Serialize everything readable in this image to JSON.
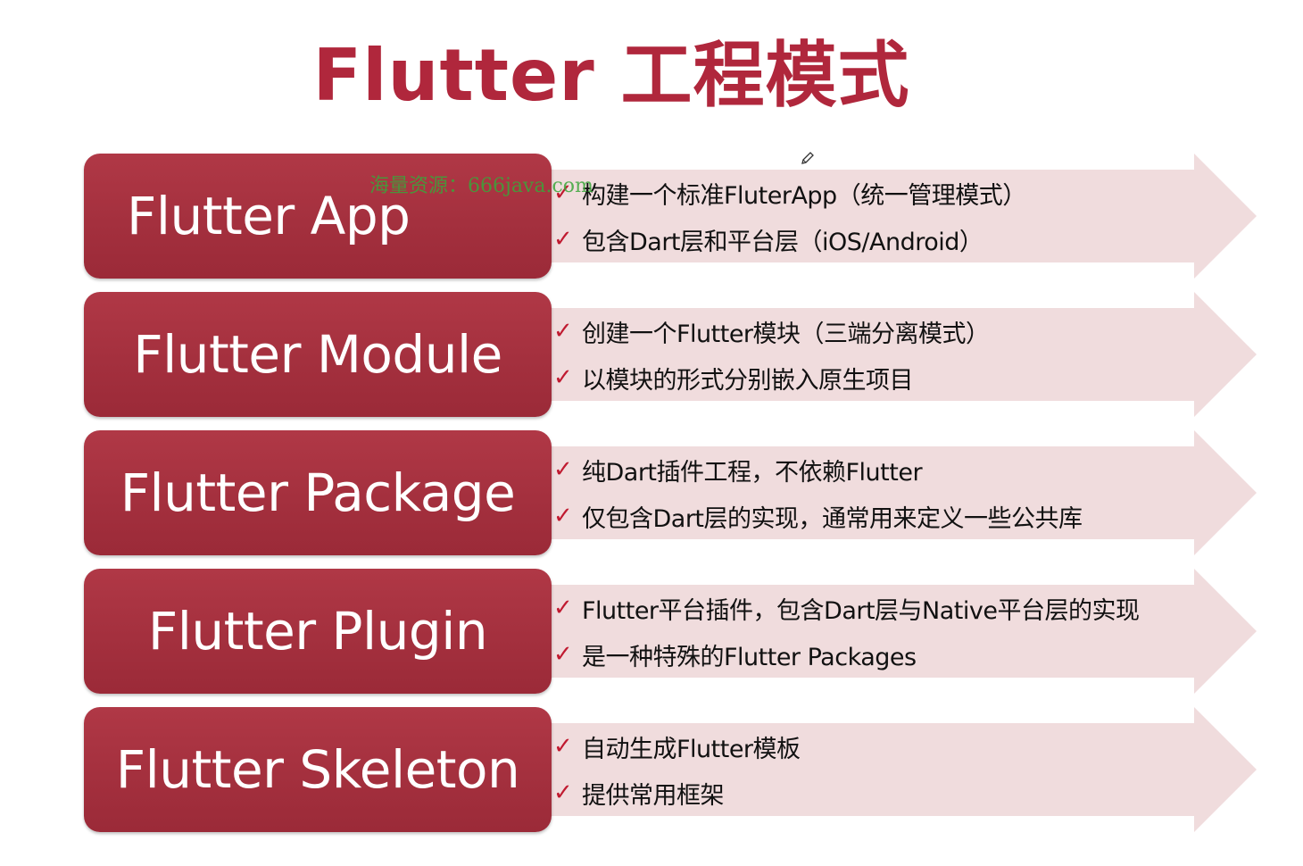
{
  "slide": {
    "title": "Flutter 工程模式",
    "watermark": "海量资源：666java.com",
    "accent_color": "#b0273c",
    "box_color": "#a4303e",
    "arrow_color": "#f0dcdd",
    "check_color": "#c01a30"
  },
  "check_glyph": "✓",
  "modes": [
    {
      "label": "Flutter App",
      "points": [
        "构建一个标准FluterApp（统一管理模式）",
        "包含Dart层和平台层（iOS/Android）"
      ]
    },
    {
      "label": "Flutter Module",
      "points": [
        "创建一个Flutter模块（三端分离模式）",
        "以模块的形式分别嵌入原生项目"
      ]
    },
    {
      "label": "Flutter Package",
      "points": [
        "纯Dart插件工程，不依赖Flutter",
        "仅包含Dart层的实现，通常用来定义一些公共库"
      ]
    },
    {
      "label": "Flutter Plugin",
      "points": [
        "Flutter平台插件，包含Dart层与Native平台层的实现",
        "是一种特殊的Flutter Packages"
      ]
    },
    {
      "label": "Flutter Skeleton",
      "points": [
        "自动生成Flutter模板",
        "提供常用框架"
      ]
    }
  ]
}
